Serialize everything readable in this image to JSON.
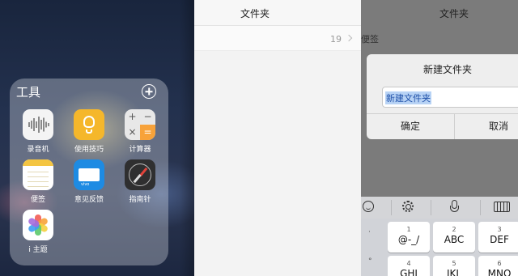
{
  "home": {
    "folder_title": "工具",
    "apps": [
      {
        "label": "录音机",
        "icon": "voice-recorder-icon"
      },
      {
        "label": "使用技巧",
        "icon": "lightbulb-icon"
      },
      {
        "label": "计算器",
        "icon": "calculator-icon"
      },
      {
        "label": "便签",
        "icon": "notes-icon"
      },
      {
        "label": "意见反馈",
        "icon": "feedback-icon"
      },
      {
        "label": "指南针",
        "icon": "compass-icon"
      },
      {
        "label": "i 主题",
        "icon": "theme-icon"
      }
    ],
    "calc_symbols": [
      "+",
      "−",
      "×",
      "="
    ],
    "feedback_brand": "vivo"
  },
  "notes": {
    "title": "文件夹",
    "row_count": "19"
  },
  "dialog_screen": {
    "title": "文件夹",
    "behind_text": "便签",
    "dialog": {
      "title": "新建文件夹",
      "input_value": "新建文件夹",
      "ok_label": "确定",
      "cancel_label": "取消"
    },
    "keyboard": {
      "keys": [
        {
          "num": "1",
          "letters": "@-_/"
        },
        {
          "num": "2",
          "letters": "ABC"
        },
        {
          "num": "3",
          "letters": "DEF"
        },
        {
          "num": "4",
          "letters": "GHI"
        },
        {
          "num": "5",
          "letters": "JKL"
        },
        {
          "num": "6",
          "letters": "MNO"
        }
      ]
    }
  }
}
